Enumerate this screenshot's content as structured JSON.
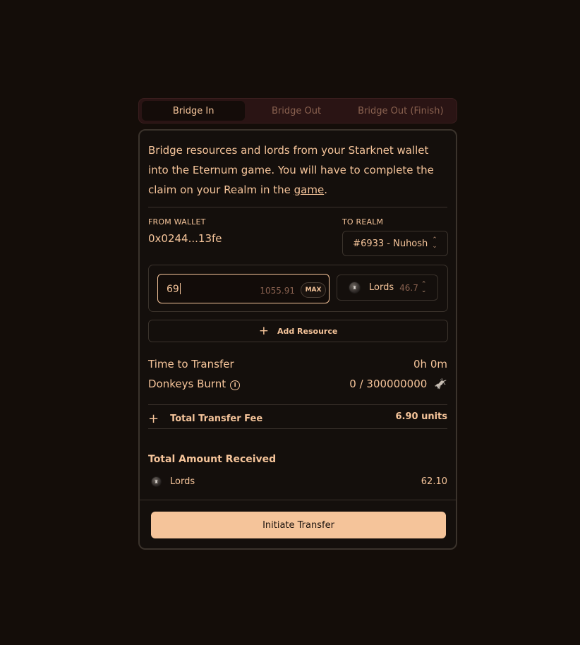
{
  "tabs": [
    {
      "label": "Bridge In",
      "active": true
    },
    {
      "label": "Bridge Out",
      "active": false
    },
    {
      "label": "Bridge Out (Finish)",
      "active": false
    }
  ],
  "intro": {
    "text_before": "Bridge resources and lords from your Starknet wallet into the Eternum game. You will have to complete the claim on your Realm in the ",
    "link_text": "game",
    "text_after": "."
  },
  "from_wallet": {
    "label": "FROM WALLET",
    "address": "0x0244...13fe"
  },
  "to_realm": {
    "label": "TO REALM",
    "selected": "#6933 - Nuhosh"
  },
  "resource": {
    "amount": "69",
    "balance": "1055.91",
    "max_label": "MAX",
    "token_icon": "lords-coin-icon",
    "token_name": "Lords",
    "token_balance": "46.7"
  },
  "add_resource_label": "Add Resource",
  "time_to_transfer": {
    "label": "Time to Transfer",
    "value": "0h 0m"
  },
  "donkeys_burnt": {
    "label": "Donkeys Burnt",
    "value": "0 / 300000000",
    "icon": "donkey-icon"
  },
  "fee": {
    "label": "Total Transfer Fee",
    "value": "6.90 units"
  },
  "received": {
    "title": "Total Amount Received",
    "token_name": "Lords",
    "value": "62.10"
  },
  "initiate_label": "Initiate Transfer",
  "colors": {
    "accent": "#f5c49a",
    "background": "#140d09",
    "muted": "#8a6250",
    "tab_bg": "#2a1414"
  }
}
